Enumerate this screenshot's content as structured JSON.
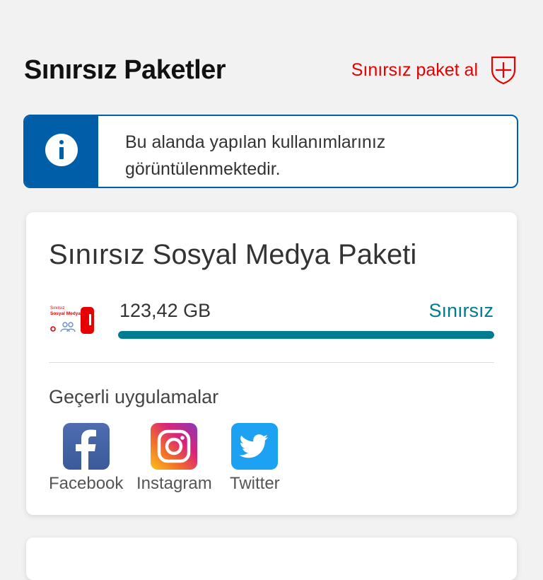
{
  "header": {
    "title": "Sınırsız Paketler",
    "buy_label": "Sınırsız paket al"
  },
  "info": {
    "text": "Bu alanda yapılan kullanımlarınız görüntülenmektedir."
  },
  "package": {
    "title": "Sınırsız Sosyal Medya Paketi",
    "logo_text": "Sınırsız Sosyal Medya",
    "usage": "123,42 GB",
    "limit": "Sınırsız",
    "progress_fraction": 1.0,
    "apps_label": "Geçerli uygulamalar",
    "apps": [
      {
        "name": "Facebook",
        "icon": "facebook-icon"
      },
      {
        "name": "Instagram",
        "icon": "instagram-icon"
      },
      {
        "name": "Twitter",
        "icon": "twitter-icon"
      }
    ]
  },
  "colors": {
    "brand_red": "#e60000",
    "info_blue": "#005ea8",
    "teal": "#007c92"
  }
}
